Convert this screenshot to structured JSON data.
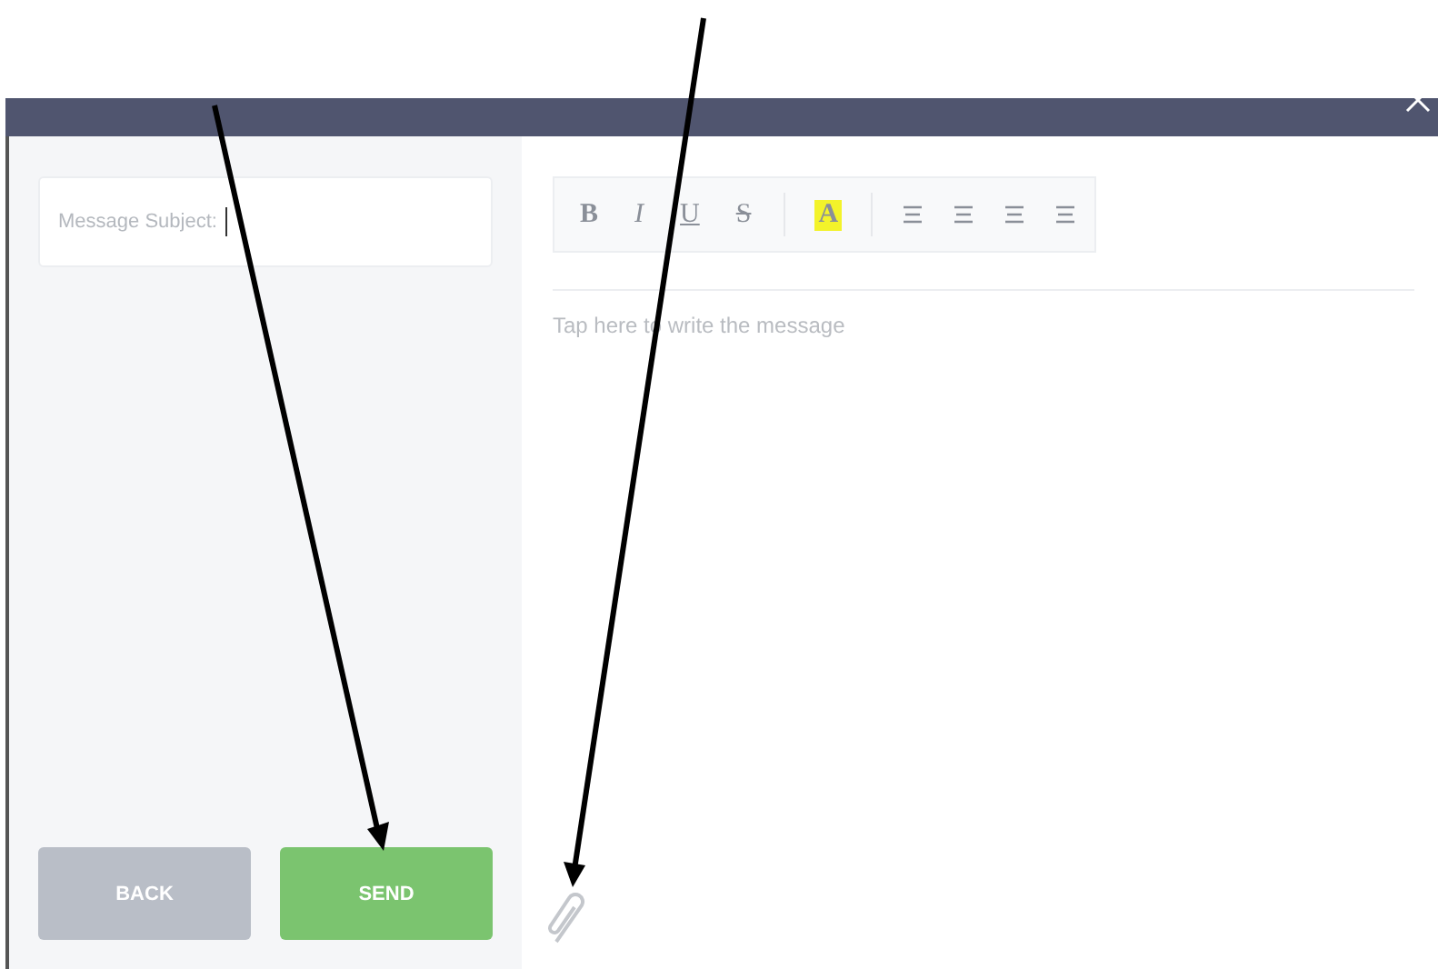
{
  "subject": {
    "placeholder": "Message Subject:",
    "focused": true
  },
  "toolbar": {
    "buttons": [
      {
        "kind": "bold",
        "label": "B"
      },
      {
        "kind": "italic",
        "label": "I"
      },
      {
        "kind": "underline",
        "label": "U"
      },
      {
        "kind": "strike",
        "label": "S"
      },
      {
        "kind": "highlight",
        "label": "A"
      },
      {
        "kind": "align"
      },
      {
        "kind": "align"
      },
      {
        "kind": "align"
      },
      {
        "kind": "align"
      }
    ]
  },
  "message": {
    "placeholder": "Tap here to write the message"
  },
  "buttons": [
    {
      "kind": "back",
      "label": "BACK"
    },
    {
      "kind": "send",
      "label": "SEND"
    }
  ]
}
